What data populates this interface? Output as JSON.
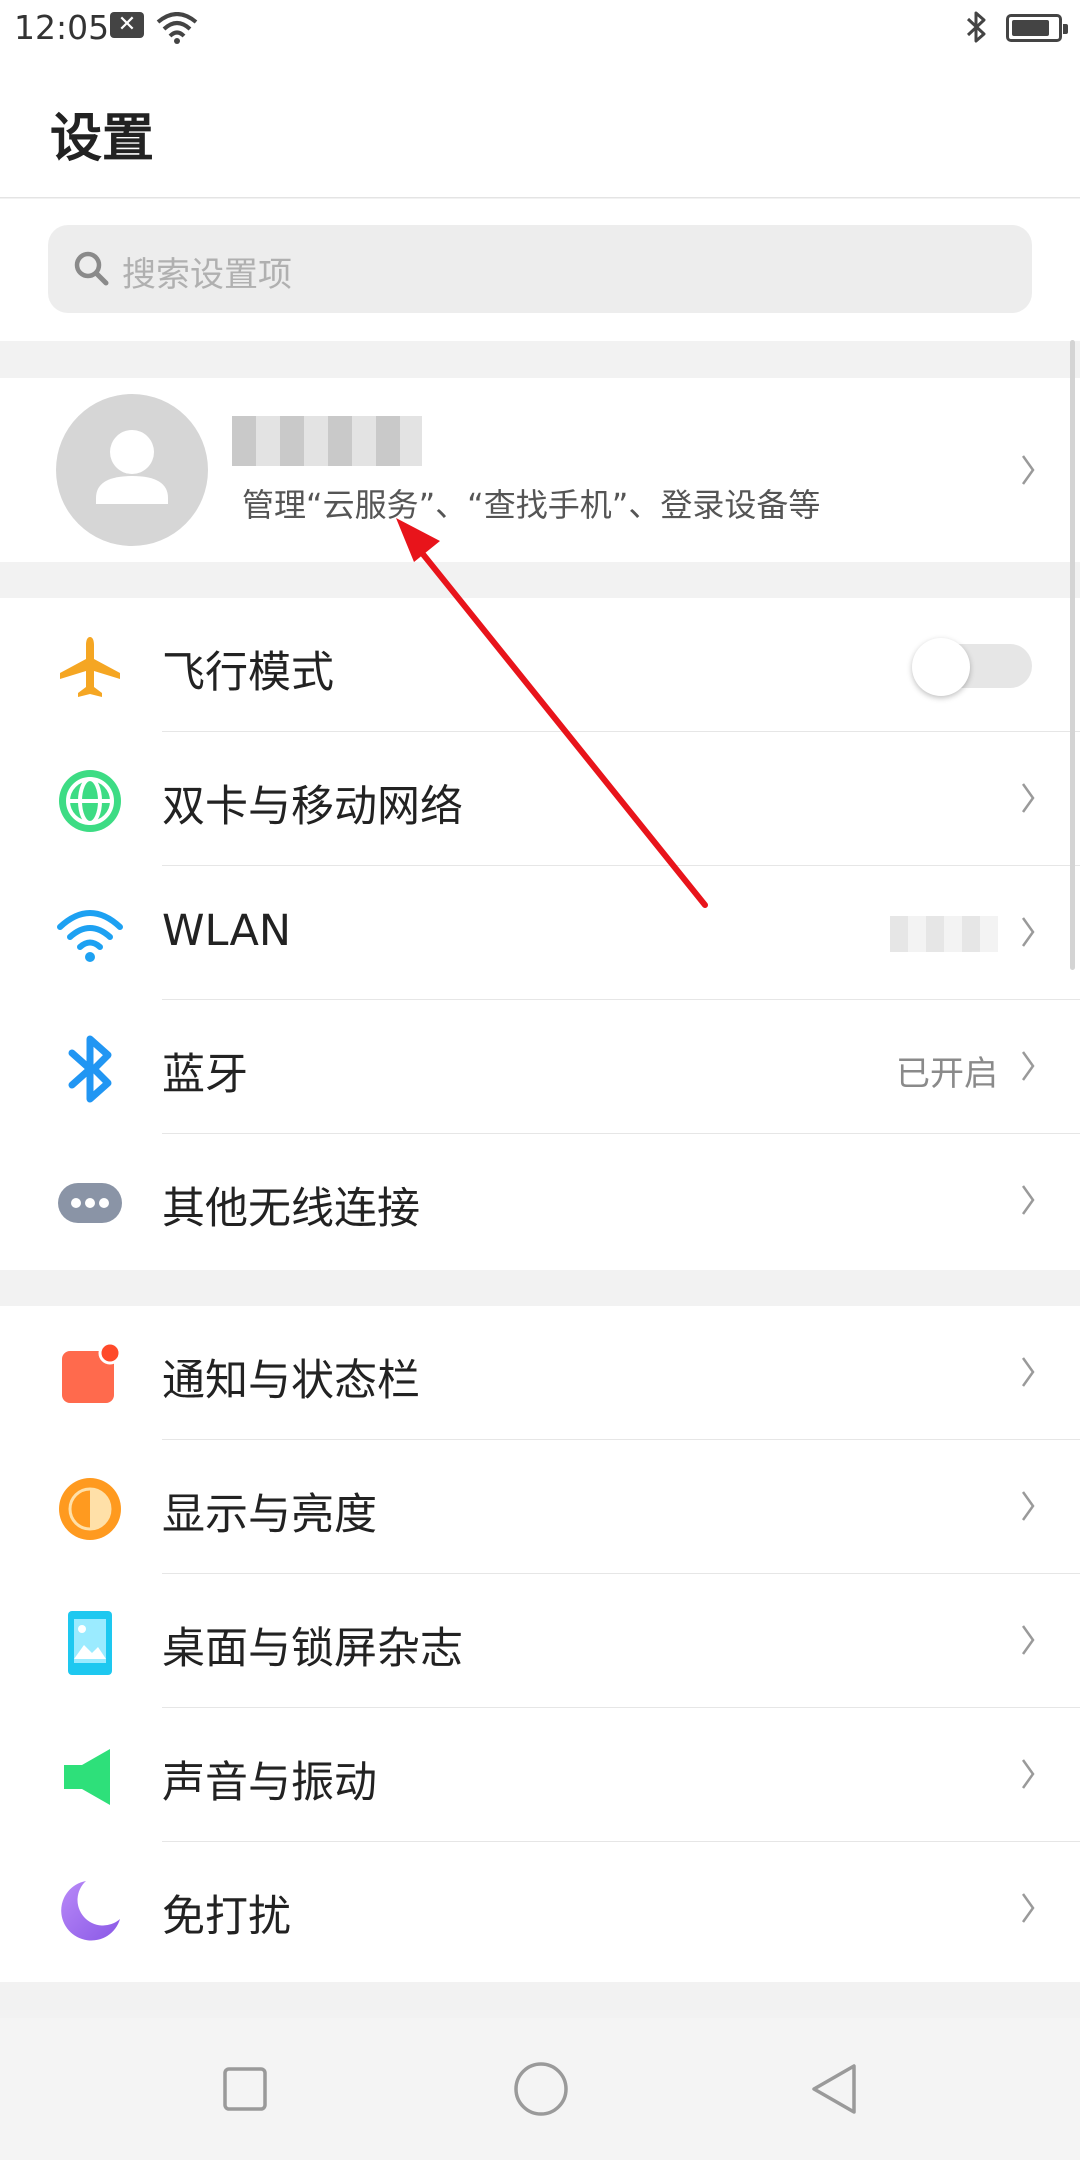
{
  "status_bar": {
    "time": "12:05",
    "notification_icon": "close-box-icon",
    "battery_level": 0.85
  },
  "header": {
    "title": "设置"
  },
  "search": {
    "placeholder": "搜索设置项"
  },
  "account": {
    "subtitle": "管理“云服务”、“查找手机”、登录设备等"
  },
  "wireless": {
    "items": [
      {
        "label": "飞行模式",
        "icon": "airplane-icon",
        "color": "#f5a623",
        "toggle_on": false
      },
      {
        "label": "双卡与移动网络",
        "icon": "globe-icon",
        "color": "#3ddc84"
      },
      {
        "label": "WLAN",
        "icon": "wifi-icon",
        "color": "#1da1f2"
      },
      {
        "label": "蓝牙",
        "value": "已开启",
        "icon": "bluetooth-icon",
        "color": "#2196f3"
      },
      {
        "label": "其他无线连接",
        "icon": "more-icon",
        "color": "#8a94a6"
      }
    ]
  },
  "personal": {
    "items": [
      {
        "label": "通知与状态栏",
        "icon": "notification-icon",
        "color": "#ff6a4d"
      },
      {
        "label": "显示与亮度",
        "icon": "brightness-icon",
        "color": "#ff9a1f"
      },
      {
        "label": "桌面与锁屏杂志",
        "icon": "wallpaper-icon",
        "color": "#1ec8f0"
      },
      {
        "label": "声音与振动",
        "icon": "speaker-icon",
        "color": "#2ee07a"
      },
      {
        "label": "免打扰",
        "icon": "moon-icon",
        "color": "#a06df0"
      }
    ]
  },
  "colors": {
    "annotation_arrow": "#e8141b"
  }
}
